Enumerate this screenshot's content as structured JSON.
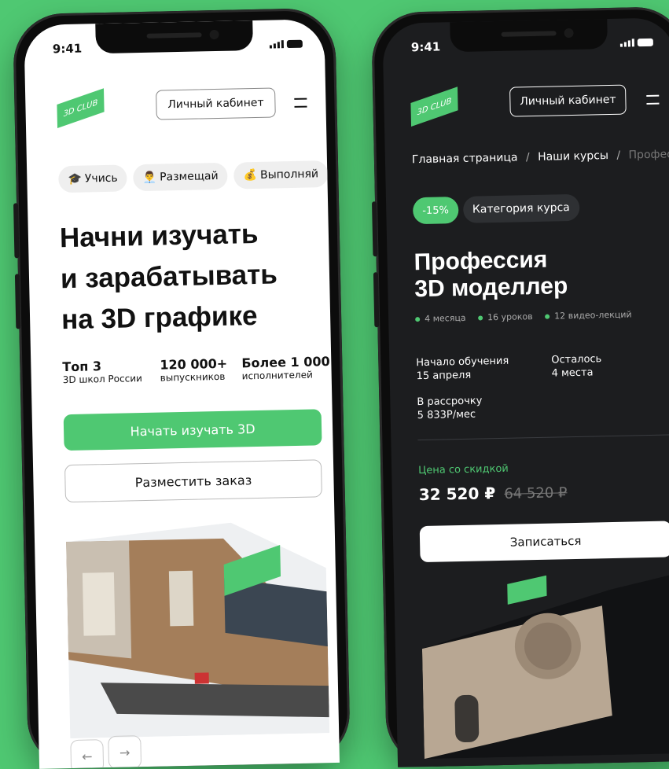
{
  "colors": {
    "accent": "#4fc872",
    "background": "#4fc872",
    "dark_screen": "#1c1d1f"
  },
  "left": {
    "time": "9:41",
    "logo": "3D CLUB",
    "cabinet": "Личный кабинет",
    "chips": [
      {
        "icon": "graduation-cap-icon",
        "glyph": "🎓",
        "label": "Учись"
      },
      {
        "icon": "person-icon",
        "glyph": "👨‍💼",
        "label": "Размещай"
      },
      {
        "icon": "money-bag-icon",
        "glyph": "💰",
        "label": "Выполняй"
      }
    ],
    "headline": [
      "Начни изучать",
      "и зарабатывать",
      "на 3D графике"
    ],
    "stats": [
      {
        "value": "Топ 3",
        "label": "3D школ России"
      },
      {
        "value": "120 000+",
        "label": "выпускников"
      },
      {
        "value": "Более 1 000",
        "label": "исполнителей"
      }
    ],
    "primary_button": "Начать изучать 3D",
    "secondary_button": "Разместить заказ",
    "prev_arrow": "←",
    "next_arrow": "→"
  },
  "right": {
    "time": "9:41",
    "logo": "3D CLUB",
    "cabinet": "Личный кабинет",
    "breadcrumbs": [
      "Главная страница",
      "Наши курсы",
      "Профес..."
    ],
    "breadcrumb_sep": "/",
    "discount_badge": "-15%",
    "category": "Категория курса",
    "title": [
      "Профессия",
      "3D моделлер"
    ],
    "meta": [
      "4 месяца",
      "16 уроков",
      "12 видео-лекций"
    ],
    "info": [
      {
        "line1": "Начало обучения",
        "line2": "15 апреля"
      },
      {
        "line1": "Осталось",
        "line2": "4 места"
      },
      {
        "line1": "В рассрочку",
        "line2": "5 833Р/мес"
      }
    ],
    "price_label": "Цена со скидкой",
    "price_new": "32 520 ₽",
    "price_old": "64 520 ₽",
    "enroll_button": "Записаться"
  }
}
